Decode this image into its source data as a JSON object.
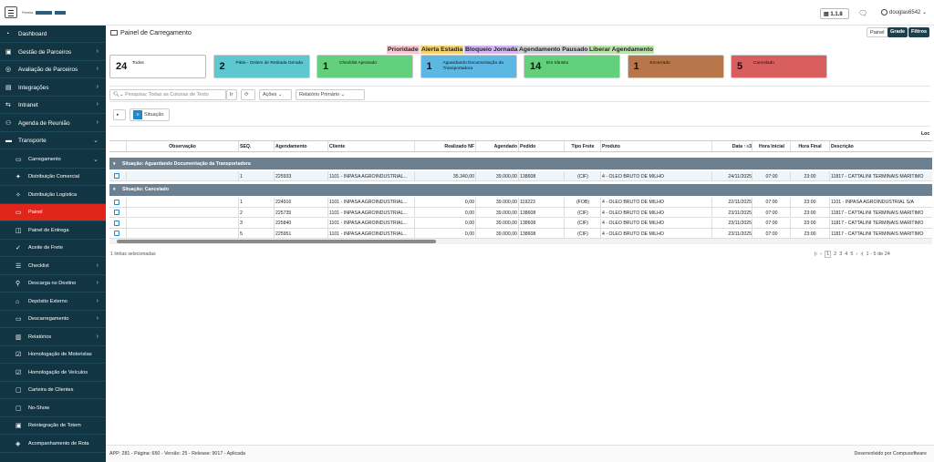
{
  "app": {
    "title": "Painel de Carregamento",
    "version": "1.1.8",
    "user": "douglas6542",
    "logo_text": "Ferreira"
  },
  "sidebar": {
    "items": [
      {
        "label": "Dashboard",
        "icon": "dashboard-icon",
        "sub": false,
        "active": false,
        "chev": ""
      },
      {
        "label": "Gestão de Parceiros",
        "icon": "partners-icon",
        "sub": false,
        "active": false,
        "chev": "›"
      },
      {
        "label": "Avaliação de Parceiros",
        "icon": "rating-icon",
        "sub": false,
        "active": false,
        "chev": "›"
      },
      {
        "label": "Integrações",
        "icon": "integrations-icon",
        "sub": false,
        "active": false,
        "chev": "›"
      },
      {
        "label": "Intranet",
        "icon": "intranet-icon",
        "sub": false,
        "active": false,
        "chev": "›"
      },
      {
        "label": "Agenda de Reunião",
        "icon": "meeting-icon",
        "sub": false,
        "active": false,
        "chev": "›"
      },
      {
        "label": "Transporte",
        "icon": "truck-icon",
        "sub": false,
        "active": false,
        "chev": "⌄"
      },
      {
        "label": "Carregamento",
        "icon": "loading-icon",
        "sub": true,
        "active": false,
        "chev": "⌄"
      },
      {
        "label": "Distribuição Comercial",
        "icon": "commercial-icon",
        "sub": true,
        "active": false,
        "chev": ""
      },
      {
        "label": "Distribuição Logística",
        "icon": "logistics-icon",
        "sub": true,
        "active": false,
        "chev": ""
      },
      {
        "label": "Painel",
        "icon": "panel-icon",
        "sub": true,
        "active": true,
        "chev": ""
      },
      {
        "label": "Painel de Entrega",
        "icon": "delivery-icon",
        "sub": true,
        "active": false,
        "chev": ""
      },
      {
        "label": "Aceite de Frete",
        "icon": "freight-icon",
        "sub": true,
        "active": false,
        "chev": ""
      },
      {
        "label": "Checklist",
        "icon": "checklist-icon",
        "sub": true,
        "active": false,
        "chev": "›"
      },
      {
        "label": "Descarga no Destino",
        "icon": "unload-icon",
        "sub": true,
        "active": false,
        "chev": "›"
      },
      {
        "label": "Depósito Externo",
        "icon": "warehouse-icon",
        "sub": true,
        "active": false,
        "chev": "›"
      },
      {
        "label": "Descarregamento",
        "icon": "unloading-icon",
        "sub": true,
        "active": false,
        "chev": "›"
      },
      {
        "label": "Relatórios",
        "icon": "reports-icon",
        "sub": true,
        "active": false,
        "chev": "›"
      },
      {
        "label": "Homologação de Motoristas",
        "icon": "drivers-icon",
        "sub": true,
        "active": false,
        "chev": ""
      },
      {
        "label": "Homologação de Veículos",
        "icon": "vehicles-icon",
        "sub": true,
        "active": false,
        "chev": ""
      },
      {
        "label": "Carteira de Clientes",
        "icon": "clients-icon",
        "sub": true,
        "active": false,
        "chev": ""
      },
      {
        "label": "No-Show",
        "icon": "noshow-icon",
        "sub": true,
        "active": false,
        "chev": ""
      },
      {
        "label": "Reintegração de Totem",
        "icon": "totem-icon",
        "sub": true,
        "active": false,
        "chev": ""
      },
      {
        "label": "Acompanhamento de Rota",
        "icon": "route-icon",
        "sub": true,
        "active": false,
        "chev": ""
      }
    ]
  },
  "top_buttons": {
    "painel": "Painel",
    "grade": "Grade",
    "filtros": "Filtros"
  },
  "legend": [
    {
      "label": "Prioridade",
      "color": "#f7c7cf"
    },
    {
      "label": "Alerta Estadia",
      "color": "#f5d26a"
    },
    {
      "label": "Bloqueio Jornada",
      "color": "#d3b6f2"
    },
    {
      "label": "Agendamento Pausado",
      "color": "#cfd3d6"
    },
    {
      "label": "Liberar Agendamento",
      "color": "#b9e3a9"
    }
  ],
  "cards": [
    {
      "count": "24",
      "label": "Todos",
      "color": "#ffffff"
    },
    {
      "count": "2",
      "label": "Pátio - Ordem de Retirada Gerada",
      "color": "#5ec8d1"
    },
    {
      "count": "1",
      "label": "Checklist Aprovado",
      "color": "#62d07d"
    },
    {
      "count": "1",
      "label": "Aguardando Documentação da Transportadora",
      "color": "#5cb8e2"
    },
    {
      "count": "14",
      "label": "Em trânsito",
      "color": "#62d07d"
    },
    {
      "count": "1",
      "label": "Encerrado",
      "color": "#b8774a"
    },
    {
      "count": "5",
      "label": "Cancelado",
      "color": "#d95f5f"
    }
  ],
  "toolbar": {
    "search_placeholder": "Pesquisa: Todas as Colunas de Texto",
    "go": "Ir",
    "actions": "Ações",
    "report": "Relatório Primário"
  },
  "group_by": {
    "label": "Situação"
  },
  "table": {
    "top_label": "Loc",
    "columns": [
      "Observação",
      "SEQ.",
      "Agendamento",
      "Cliente",
      "Realizado NF",
      "Agendado",
      "Pedido",
      "Tipo Frete",
      "Produto",
      "Data ↑≡3",
      "Hora Inicial",
      "Hora Final",
      "Descrição"
    ],
    "groups": [
      {
        "title": "Situação: Aguardando Documentação da Transportadora",
        "rows": [
          [
            "",
            "1",
            "225933",
            "1101 - INPASA AGROINDUSTRIAL...",
            "35.340,00",
            "39.000,00",
            "138608",
            "(CIF)",
            "4 - ÓLEO BRUTO DE MILHO",
            "24/11/2025",
            "07:00",
            "23:00",
            "11817 - CATTALINI TERMINAIS MARITIMO"
          ]
        ]
      },
      {
        "title": "Situação: Cancelado",
        "rows": [
          [
            "",
            "1",
            "224916",
            "1101 - INPASA AGROINDUSTRIAL...",
            "0,00",
            "39.000,00",
            "119223",
            "(FOB)",
            "4 - ÓLEO BRUTO DE MILHO",
            "22/11/2025",
            "07:00",
            "23:00",
            "1101 - INPASA AGROINDUSTRIAL S/A"
          ],
          [
            "",
            "2",
            "225735",
            "1101 - INPASA AGROINDUSTRIAL...",
            "0,00",
            "39.000,00",
            "138608",
            "(CIF)",
            "4 - ÓLEO BRUTO DE MILHO",
            "23/11/2025",
            "07:00",
            "23:00",
            "11817 - CATTALINI TERMINAIS MARITIMO"
          ],
          [
            "",
            "3",
            "225840",
            "1101 - INPASA AGROINDUSTRIAL...",
            "0,00",
            "39.000,00",
            "138608",
            "(CIF)",
            "4 - ÓLEO BRUTO DE MILHO",
            "23/11/2025",
            "07:00",
            "23:00",
            "11817 - CATTALINI TERMINAIS MARITIMO"
          ],
          [
            "",
            "5",
            "225951",
            "1101 - INPASA AGROINDUSTRIAL...",
            "0,00",
            "39.000,00",
            "138608",
            "(CIF)",
            "4 - ÓLEO BRUTO DE MILHO",
            "23/11/2025",
            "07:00",
            "23:00",
            "11817 - CATTALINI TERMINAIS MARITIMO"
          ]
        ]
      }
    ]
  },
  "footer": {
    "selected": "1 linhas selecionadas",
    "pages": [
      "1",
      "2",
      "3",
      "4",
      "5"
    ],
    "range": "1 - 5 de 24"
  },
  "bottom": {
    "left": "APP: 281 - Página: 650 - Versão: 25 - Release: 9017 - Aplicada",
    "right": "Desenvolvido por  Compusoftware"
  }
}
